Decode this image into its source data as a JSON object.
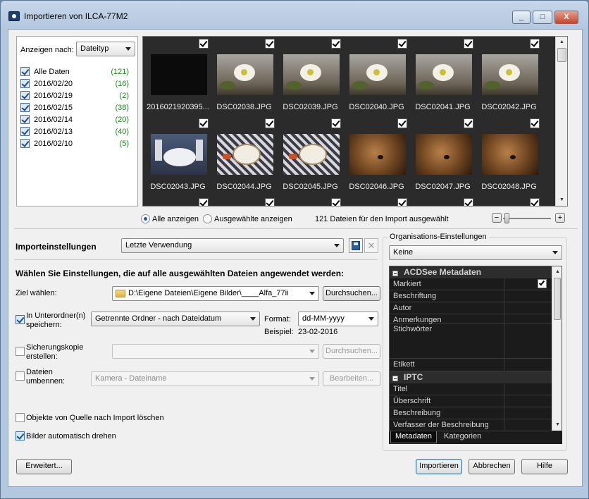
{
  "window": {
    "title": "Importieren von ILCA-77M2",
    "min": "_",
    "max": "□",
    "close": "X"
  },
  "left": {
    "show_by_label": "Anzeigen nach:",
    "show_by_value": "Dateityp",
    "dates": [
      {
        "label": "Alle Daten",
        "count": "(121)"
      },
      {
        "label": "2016/02/20",
        "count": "(16)"
      },
      {
        "label": "2016/02/19",
        "count": "(2)"
      },
      {
        "label": "2016/02/15",
        "count": "(38)"
      },
      {
        "label": "2016/02/14",
        "count": "(20)"
      },
      {
        "label": "2016/02/13",
        "count": "(40)"
      },
      {
        "label": "2016/02/10",
        "count": "(5)"
      }
    ]
  },
  "thumbs": [
    {
      "name": "2016021920395...",
      "kind": "black"
    },
    {
      "name": "DSC02038.JPG",
      "kind": "flower"
    },
    {
      "name": "DSC02039.JPG",
      "kind": "flower"
    },
    {
      "name": "DSC02040.JPG",
      "kind": "flower"
    },
    {
      "name": "DSC02041.JPG",
      "kind": "flower"
    },
    {
      "name": "DSC02042.JPG",
      "kind": "flower"
    },
    {
      "name": "DSC02043.JPG",
      "kind": "table"
    },
    {
      "name": "DSC02044.JPG",
      "kind": "table2"
    },
    {
      "name": "DSC02045.JPG",
      "kind": "table2"
    },
    {
      "name": "DSC02046.JPG",
      "kind": "dog"
    },
    {
      "name": "DSC02047.JPG",
      "kind": "dog"
    },
    {
      "name": "DSC02048.JPG",
      "kind": "dog"
    }
  ],
  "view": {
    "show_all": "Alle anzeigen",
    "show_selected": "Ausgewählte anzeigen",
    "count_text": "121 Dateien für den Import ausgewählt",
    "zoom_minus": "−",
    "zoom_plus": "+"
  },
  "import": {
    "settings_label": "Importeinstellungen",
    "settings_value": "Letzte Verwendung",
    "apply_heading": "Wählen Sie Einstellungen, die auf alle ausgewählten Dateien angewendet werden:",
    "target_label": "Ziel wählen:",
    "target_value": "D:\\Eigene Dateien\\Eigene Bilder\\____Alfa_77ii",
    "browse": "Durchsuchen...",
    "subfolder_label_1": "In Unterordner(n)",
    "subfolder_label_2": "speichern:",
    "subfolder_value": "Getrennte Ordner - nach Dateidatum",
    "format_label": "Format:",
    "format_value": "dd-MM-yyyy",
    "example_label": "Beispiel:",
    "example_value": "23-02-2016",
    "backup_label_1": "Sicherungskopie",
    "backup_label_2": "erstellen:",
    "backup_browse": "Durchsuchen...",
    "rename_label_1": "Dateien",
    "rename_label_2": "umbennen:",
    "rename_value": "Kamera - Dateiname",
    "rename_edit": "Bearbeiten...",
    "delete_label": "Objekte von Quelle nach Import löschen",
    "rotate_label": "Bilder automatisch drehen"
  },
  "org": {
    "title": "Organisations-Einstellungen",
    "value": "Keine",
    "section1": "ACDSee Metadaten",
    "rows1": [
      "Markiert",
      "Beschriftung",
      "Autor",
      "Anmerkungen",
      "Stichwörter",
      "Etikett"
    ],
    "section2": "IPTC",
    "rows2": [
      "Titel",
      "Überschrift",
      "Beschreibung",
      "Verfasser der Beschreibung"
    ],
    "tab1": "Metadaten",
    "tab2": "Kategorien"
  },
  "footer": {
    "advanced": "Erweitert...",
    "import": "Importieren",
    "cancel": "Abbrechen",
    "help": "Hilfe"
  }
}
